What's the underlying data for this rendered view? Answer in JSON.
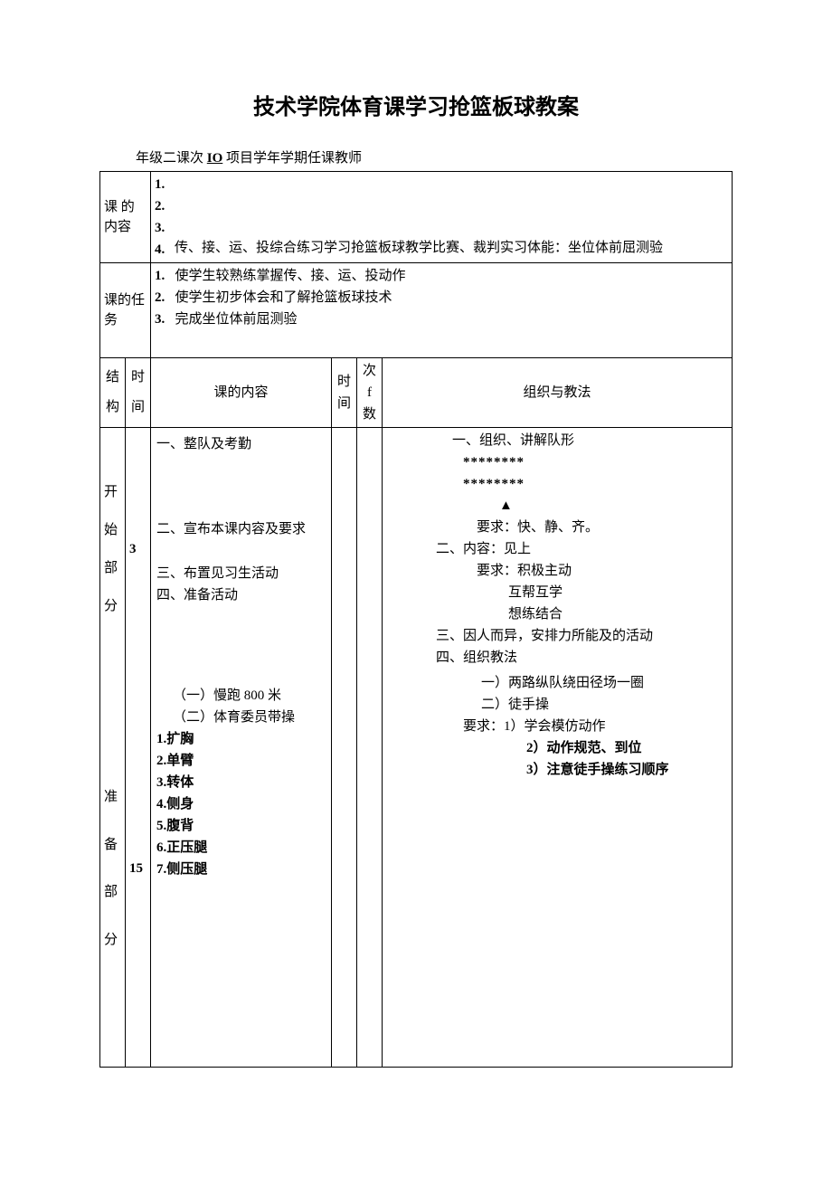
{
  "title": "技术学院体育课学习抢篮板球教案",
  "meta": {
    "line": "年级二课次 ",
    "io": "IO",
    "line2": " 项目学年学期任课教师"
  },
  "row1": {
    "label": "课 的内容",
    "nums": [
      "1.",
      "2.",
      "3.",
      "4."
    ],
    "text": "传、接、运、投综合练习学习抢篮板球教学比赛、裁判实习体能：坐位体前屈测验"
  },
  "row2": {
    "label": "课的任务",
    "items": [
      {
        "n": "1.",
        "t": "使学生较熟练掌握传、接、运、投动作"
      },
      {
        "n": "2.",
        "t": "使学生初步体会和了解抢篮板球技术"
      },
      {
        "n": "3.",
        "t": "完成坐位体前屈测验"
      }
    ]
  },
  "headers": {
    "c1": "结构",
    "c2": "时间",
    "c3": "课的内容",
    "c4": "时间",
    "c5": "次f数",
    "c6": "组织与教法"
  },
  "section1": {
    "label": "开始部分",
    "time": "3",
    "content": {
      "l1": "一、整队及考勤",
      "l2": "二、宣布本课内容及要求",
      "l3": "三、布置见习生活动",
      "l4": "四、准备活动"
    },
    "org": {
      "o1": "一、组织、讲解队形",
      "stars": "********",
      "tri": "▲",
      "req1": "要求：快、静、齐。",
      "o2": "二、内容：见上",
      "req2": "要求：积极主动",
      "req3": "互帮互学",
      "req4": "想练结合",
      "o3": "三、因人而异，安排力所能及的活动",
      "o4": "四、组织教法"
    }
  },
  "section2": {
    "label": "准备部分",
    "time": "15",
    "content": {
      "c1": "（一）慢跑 800 米",
      "c2": "（二）体育委员带操",
      "e1": "1.扩胸",
      "e2": "2.单臂",
      "e3": "3.转体",
      "e4": "4.侧身",
      "e5": "5.腹背",
      "e6": "6.正压腿",
      "e7": "7.侧压腿"
    },
    "org": {
      "m1": "一）两路纵队绕田径场一圈",
      "m2": "二）徒手操",
      "req": "要求：1）学会模仿动作",
      "r2": "2）动作规范、到位",
      "r3": "3）注意徒手操练习顺序"
    }
  }
}
